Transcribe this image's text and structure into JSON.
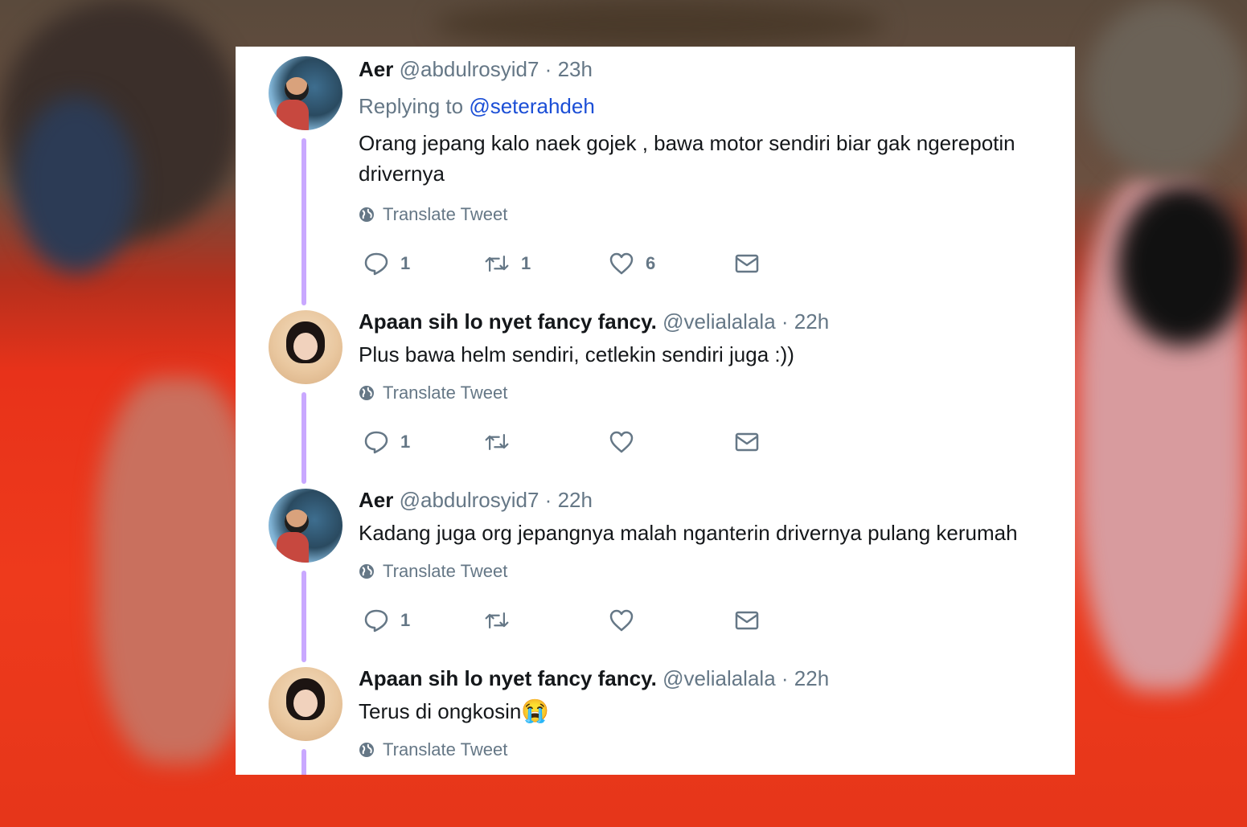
{
  "tweets": [
    {
      "name": "Aer",
      "handle": "@abdulrosyid7",
      "separator": "·",
      "time": "23h",
      "replying_label": "Replying to",
      "replying_to": "@seterahdeh",
      "text": "Orang jepang kalo naek gojek , bawa motor sendiri biar gak ngerepotin drivernya",
      "translate": "Translate Tweet",
      "replies": "1",
      "retweets": "1",
      "likes": "6"
    },
    {
      "name": "Apaan sih lo nyet fancy fancy.",
      "handle": "@velialalala",
      "separator": "·",
      "time": "22h",
      "text": "Plus bawa helm sendiri, cetlekin sendiri juga :))",
      "translate": "Translate Tweet",
      "replies": "1",
      "retweets": "",
      "likes": ""
    },
    {
      "name": "Aer",
      "handle": "@abdulrosyid7",
      "separator": "·",
      "time": "22h",
      "text": "Kadang juga org jepangnya malah nganterin drivernya pulang kerumah",
      "translate": "Translate Tweet",
      "replies": "1",
      "retweets": "",
      "likes": ""
    },
    {
      "name": "Apaan sih lo nyet fancy fancy.",
      "handle": "@velialalala",
      "separator": "·",
      "time": "22h",
      "text": "Terus di ongkosin",
      "emoji": "😭",
      "translate": "Translate Tweet"
    }
  ],
  "colors": {
    "thread_line": "#c9a8ff",
    "mention": "#1b4ed6",
    "muted": "#657786"
  },
  "icons": [
    "reply-icon",
    "retweet-icon",
    "like-icon",
    "dm-icon",
    "globe-icon"
  ]
}
